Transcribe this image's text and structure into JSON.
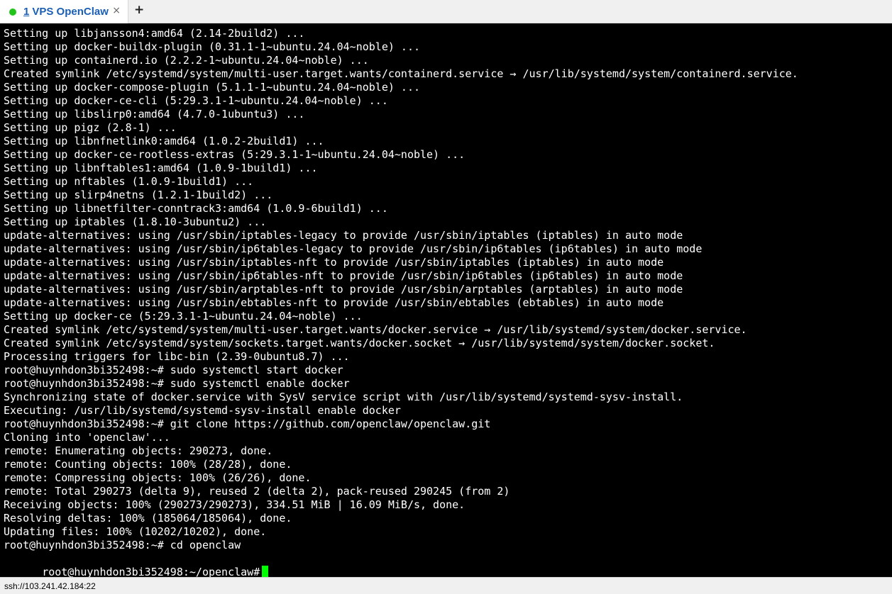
{
  "colors": {
    "status_dot": "#22c31a",
    "cursor": "#00ff00",
    "terminal_bg": "#000000",
    "terminal_fg": "#ffffff",
    "tab_title": "#1a5fb4"
  },
  "tabbar": {
    "tab": {
      "index": "1",
      "title": "VPS OpenClaw",
      "close_icon": "×"
    },
    "new_tab_icon": "+"
  },
  "terminal": {
    "lines": [
      "Setting up libjansson4:amd64 (2.14-2build2) ...",
      "Setting up docker-buildx-plugin (0.31.1-1~ubuntu.24.04~noble) ...",
      "Setting up containerd.io (2.2.2-1~ubuntu.24.04~noble) ...",
      "Created symlink /etc/systemd/system/multi-user.target.wants/containerd.service → /usr/lib/systemd/system/containerd.service.",
      "Setting up docker-compose-plugin (5.1.1-1~ubuntu.24.04~noble) ...",
      "Setting up docker-ce-cli (5:29.3.1-1~ubuntu.24.04~noble) ...",
      "Setting up libslirp0:amd64 (4.7.0-1ubuntu3) ...",
      "Setting up pigz (2.8-1) ...",
      "Setting up libnfnetlink0:amd64 (1.0.2-2build1) ...",
      "Setting up docker-ce-rootless-extras (5:29.3.1-1~ubuntu.24.04~noble) ...",
      "Setting up libnftables1:amd64 (1.0.9-1build1) ...",
      "Setting up nftables (1.0.9-1build1) ...",
      "Setting up slirp4netns (1.2.1-1build2) ...",
      "Setting up libnetfilter-conntrack3:amd64 (1.0.9-6build1) ...",
      "Setting up iptables (1.8.10-3ubuntu2) ...",
      "update-alternatives: using /usr/sbin/iptables-legacy to provide /usr/sbin/iptables (iptables) in auto mode",
      "update-alternatives: using /usr/sbin/ip6tables-legacy to provide /usr/sbin/ip6tables (ip6tables) in auto mode",
      "update-alternatives: using /usr/sbin/iptables-nft to provide /usr/sbin/iptables (iptables) in auto mode",
      "update-alternatives: using /usr/sbin/ip6tables-nft to provide /usr/sbin/ip6tables (ip6tables) in auto mode",
      "update-alternatives: using /usr/sbin/arptables-nft to provide /usr/sbin/arptables (arptables) in auto mode",
      "update-alternatives: using /usr/sbin/ebtables-nft to provide /usr/sbin/ebtables (ebtables) in auto mode",
      "Setting up docker-ce (5:29.3.1-1~ubuntu.24.04~noble) ...",
      "Created symlink /etc/systemd/system/multi-user.target.wants/docker.service → /usr/lib/systemd/system/docker.service.",
      "Created symlink /etc/systemd/system/sockets.target.wants/docker.socket → /usr/lib/systemd/system/docker.socket.",
      "Processing triggers for libc-bin (2.39-0ubuntu8.7) ...",
      "root@huynhdon3bi352498:~# sudo systemctl start docker",
      "root@huynhdon3bi352498:~# sudo systemctl enable docker",
      "Synchronizing state of docker.service with SysV service script with /usr/lib/systemd/systemd-sysv-install.",
      "Executing: /usr/lib/systemd/systemd-sysv-install enable docker",
      "root@huynhdon3bi352498:~# git clone https://github.com/openclaw/openclaw.git",
      "Cloning into 'openclaw'...",
      "remote: Enumerating objects: 290273, done.",
      "remote: Counting objects: 100% (28/28), done.",
      "remote: Compressing objects: 100% (26/26), done.",
      "remote: Total 290273 (delta 9), reused 2 (delta 2), pack-reused 290245 (from 2)",
      "Receiving objects: 100% (290273/290273), 334.51 MiB | 16.09 MiB/s, done.",
      "Resolving deltas: 100% (185064/185064), done.",
      "Updating files: 100% (10202/10202), done.",
      "root@huynhdon3bi352498:~# cd openclaw"
    ],
    "current_prompt": "root@huynhdon3bi352498:~/openclaw#"
  },
  "statusbar": {
    "connection": "ssh://103.241.42.184:22"
  }
}
